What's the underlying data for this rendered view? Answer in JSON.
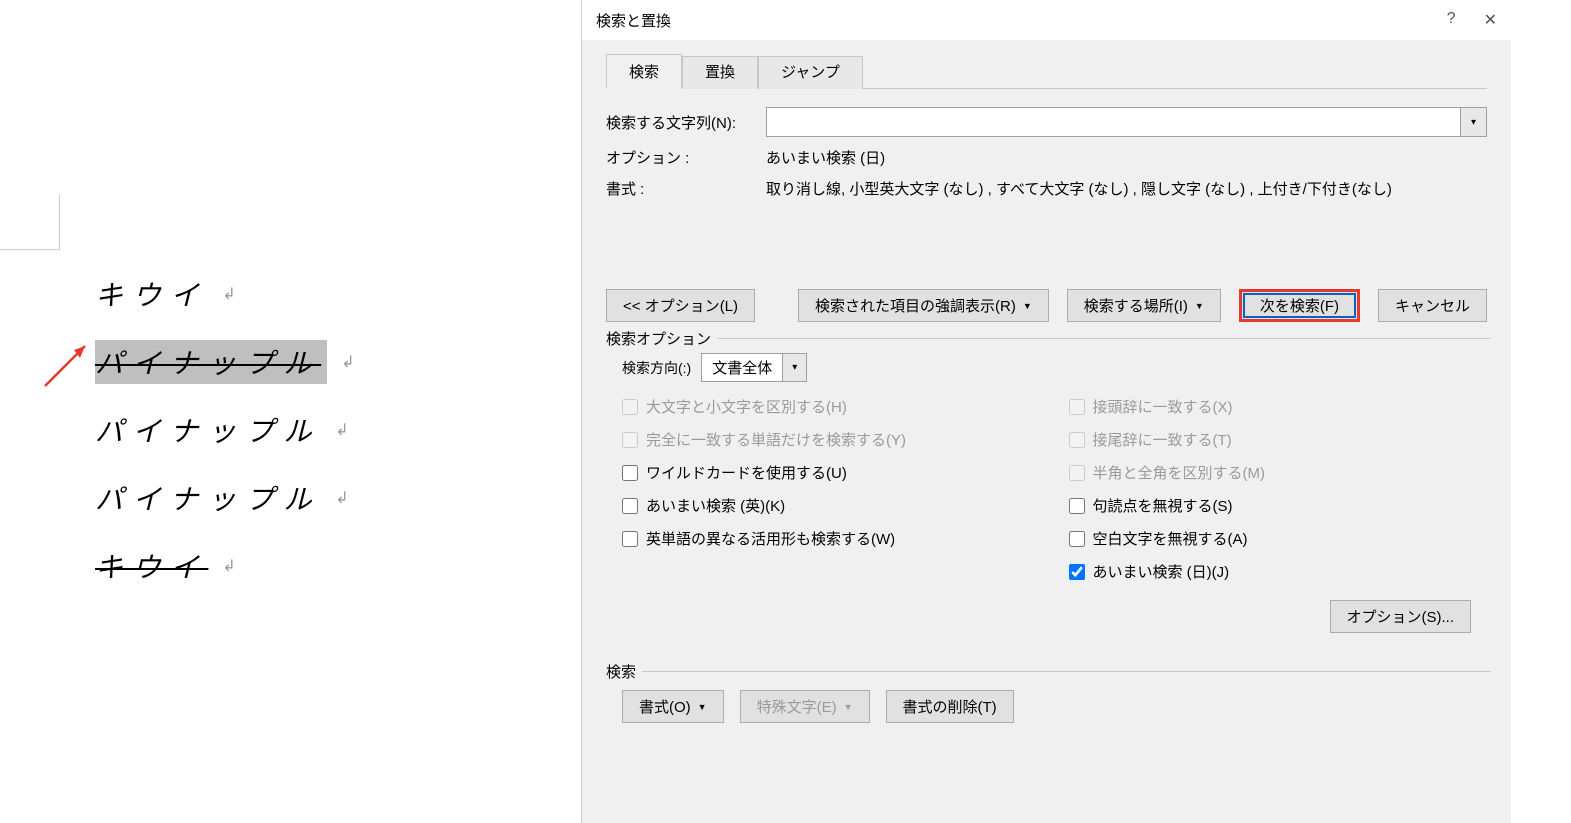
{
  "document": {
    "lines": [
      {
        "text": "キウイ",
        "strike": false,
        "highlight": false
      },
      {
        "text": "パイナップル",
        "strike": true,
        "highlight": true
      },
      {
        "text": "パイナップル",
        "strike": false,
        "highlight": false
      },
      {
        "text": "パイナップル",
        "strike": false,
        "highlight": false
      },
      {
        "text": "キウイ",
        "strike": true,
        "highlight": false
      }
    ]
  },
  "dialog": {
    "title": "検索と置換",
    "help_icon": "?",
    "close_icon": "✕",
    "tabs": {
      "search": "検索",
      "replace": "置換",
      "jump": "ジャンプ"
    },
    "search_label": "検索する文字列(N):",
    "search_value": "",
    "options_label": "オプション :",
    "options_value": "あいまい検索 (日)",
    "format_label": "書式 :",
    "format_value": "取り消し線, 小型英大文字 (なし) , すべて大文字 (なし) , 隠し文字 (なし) , 上付き/下付き(なし)",
    "buttons": {
      "less_options": "<< オプション(L)",
      "highlight_results": "検索された項目の強調表示(R)",
      "search_in": "検索する場所(I)",
      "find_next": "次を検索(F)",
      "cancel": "キャンセル"
    },
    "search_options": {
      "legend": "検索オプション",
      "direction_label": "検索方向(:)",
      "direction_value": "文書全体",
      "checkboxes": {
        "match_case": "大文字と小文字を区別する(H)",
        "prefix": "接頭辞に一致する(X)",
        "whole_word": "完全に一致する単語だけを検索する(Y)",
        "suffix": "接尾辞に一致する(T)",
        "wildcard": "ワイルドカードを使用する(U)",
        "half_full": "半角と全角を区別する(M)",
        "fuzzy_en": "あいまい検索 (英)(K)",
        "ignore_punct": "句読点を無視する(S)",
        "word_forms": "英単語の異なる活用形も検索する(W)",
        "ignore_space": "空白文字を無視する(A)",
        "fuzzy_jp": "あいまい検索 (日)(J)"
      },
      "options_button": "オプション(S)..."
    },
    "bottom": {
      "legend": "検索",
      "format": "書式(O)",
      "special": "特殊文字(E)",
      "clear_format": "書式の削除(T)"
    }
  }
}
